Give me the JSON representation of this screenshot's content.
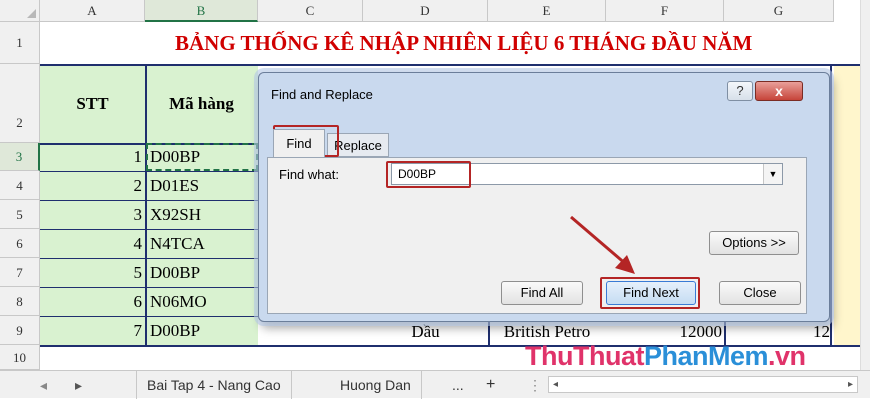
{
  "columns": [
    "A",
    "B",
    "C",
    "D",
    "E",
    "F",
    "G"
  ],
  "rows": [
    "1",
    "2",
    "3",
    "4",
    "5",
    "6",
    "7",
    "8",
    "9",
    "10"
  ],
  "title": "BẢNG THỐNG KÊ NHẬP NHIÊN LIỆU 6 THÁNG ĐẦU NĂM",
  "headers": {
    "stt": "STT",
    "ma_hang": "Mã hàng"
  },
  "data_rows": [
    {
      "stt": "1",
      "code": "D00BP"
    },
    {
      "stt": "2",
      "code": "D01ES"
    },
    {
      "stt": "3",
      "code": "X92SH"
    },
    {
      "stt": "4",
      "code": "N4TCA"
    },
    {
      "stt": "5",
      "code": "D00BP"
    },
    {
      "stt": "6",
      "code": "N06MO"
    },
    {
      "stt": "7",
      "code": "D00BP",
      "d": "Dầu",
      "e": "British Petro",
      "f": "12000",
      "g": "12"
    }
  ],
  "dialog": {
    "title": "Find and Replace",
    "help": "?",
    "close": "x",
    "tab_find": "Find",
    "tab_replace": "Replace",
    "find_what_label": "Find what:",
    "find_value": "D00BP",
    "options_button": "Options >>",
    "find_all": "Find All",
    "find_next": "Find Next",
    "close_button": "Close"
  },
  "tabs": {
    "sheet1": "Bai Tap 4 - Nang Cao",
    "sheet2": "Huong Dan",
    "more": "...",
    "add": "+"
  },
  "watermark": {
    "part1": "ThuThuat",
    "part2": "PhanMem",
    "part3": ".vn",
    "color1": "#e0336a",
    "color2": "#2a8fd8"
  },
  "colors": {
    "accent_red": "#b42525",
    "excel_green": "#217346"
  }
}
